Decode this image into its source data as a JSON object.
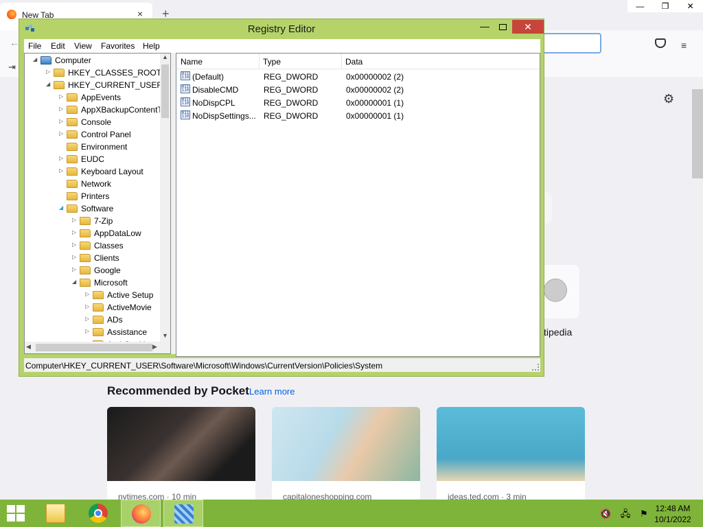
{
  "browser": {
    "tab_title": "New Tab",
    "tab_close": "×",
    "new_tab": "+",
    "window_controls": {
      "minimize": "—",
      "maximize": "❐",
      "close": "✕"
    },
    "back_icon": "←",
    "import_icon": "⇥",
    "menu_icon": "≡",
    "gear_icon": "⚙",
    "wikipedia_label": "tipedia",
    "pocket": {
      "title": "Recommended by Pocket",
      "learn_more": "Learn more",
      "cards": [
        {
          "source": "nytimes.com · 10 min"
        },
        {
          "source": "capitaloneshopping.com"
        },
        {
          "source": "ideas.ted.com · 3 min"
        }
      ]
    }
  },
  "regedit": {
    "title": "Registry Editor",
    "buttons": {
      "minimize": "—",
      "close": "✕"
    },
    "menu": [
      "File",
      "Edit",
      "View",
      "Favorites",
      "Help"
    ],
    "tree": [
      {
        "label": "Computer",
        "depth": 0,
        "expander": "expanded",
        "icon": "computer-icon"
      },
      {
        "label": "HKEY_CLASSES_ROOT",
        "depth": 1,
        "expander": "collapsed"
      },
      {
        "label": "HKEY_CURRENT_USER",
        "depth": 1,
        "expander": "expanded"
      },
      {
        "label": "AppEvents",
        "depth": 2,
        "expander": "collapsed"
      },
      {
        "label": "AppXBackupContentT",
        "depth": 2,
        "expander": "collapsed"
      },
      {
        "label": "Console",
        "depth": 2,
        "expander": "collapsed"
      },
      {
        "label": "Control Panel",
        "depth": 2,
        "expander": "collapsed"
      },
      {
        "label": "Environment",
        "depth": 2,
        "expander": "none"
      },
      {
        "label": "EUDC",
        "depth": 2,
        "expander": "collapsed"
      },
      {
        "label": "Keyboard Layout",
        "depth": 2,
        "expander": "collapsed"
      },
      {
        "label": "Network",
        "depth": 2,
        "expander": "none"
      },
      {
        "label": "Printers",
        "depth": 2,
        "expander": "none"
      },
      {
        "label": "Software",
        "depth": 2,
        "expander": "expanded-blue"
      },
      {
        "label": "7-Zip",
        "depth": 3,
        "expander": "collapsed"
      },
      {
        "label": "AppDataLow",
        "depth": 3,
        "expander": "collapsed"
      },
      {
        "label": "Classes",
        "depth": 3,
        "expander": "collapsed"
      },
      {
        "label": "Clients",
        "depth": 3,
        "expander": "collapsed"
      },
      {
        "label": "Google",
        "depth": 3,
        "expander": "collapsed"
      },
      {
        "label": "Microsoft",
        "depth": 3,
        "expander": "expanded"
      },
      {
        "label": "Active Setup",
        "depth": 4,
        "expander": "collapsed"
      },
      {
        "label": "ActiveMovie",
        "depth": 4,
        "expander": "collapsed"
      },
      {
        "label": "ADs",
        "depth": 4,
        "expander": "collapsed"
      },
      {
        "label": "Assistance",
        "depth": 4,
        "expander": "collapsed"
      },
      {
        "label": "AuthCookies",
        "depth": 4,
        "expander": "collapsed"
      }
    ],
    "columns": {
      "name": "Name",
      "type": "Type",
      "data": "Data"
    },
    "values": [
      {
        "name": "(Default)",
        "type": "REG_DWORD",
        "data": "0x00000002 (2)"
      },
      {
        "name": "DisableCMD",
        "type": "REG_DWORD",
        "data": "0x00000002 (2)"
      },
      {
        "name": "NoDispCPL",
        "type": "REG_DWORD",
        "data": "0x00000001 (1)"
      },
      {
        "name": "NoDispSettings...",
        "type": "REG_DWORD",
        "data": "0x00000001 (1)"
      }
    ],
    "status_path": "Computer\\HKEY_CURRENT_USER\\Software\\Microsoft\\Windows\\CurrentVersion\\Policies\\System"
  },
  "taskbar": {
    "time": "12:48 AM",
    "date": "10/1/2022",
    "apps": [
      "file-explorer",
      "chrome",
      "firefox",
      "registry-editor"
    ],
    "active_app": "firefox",
    "tray_icons": [
      "volume-muted-icon",
      "network-icon",
      "action-center-icon"
    ],
    "tray_glyphs": [
      "🔇",
      "🖧",
      "⚑"
    ]
  },
  "colors": {
    "window_frame": "#b6d36a",
    "close_button": "#c7453a",
    "taskbar": "#7fb43a",
    "pocket_link": "#0060df"
  }
}
